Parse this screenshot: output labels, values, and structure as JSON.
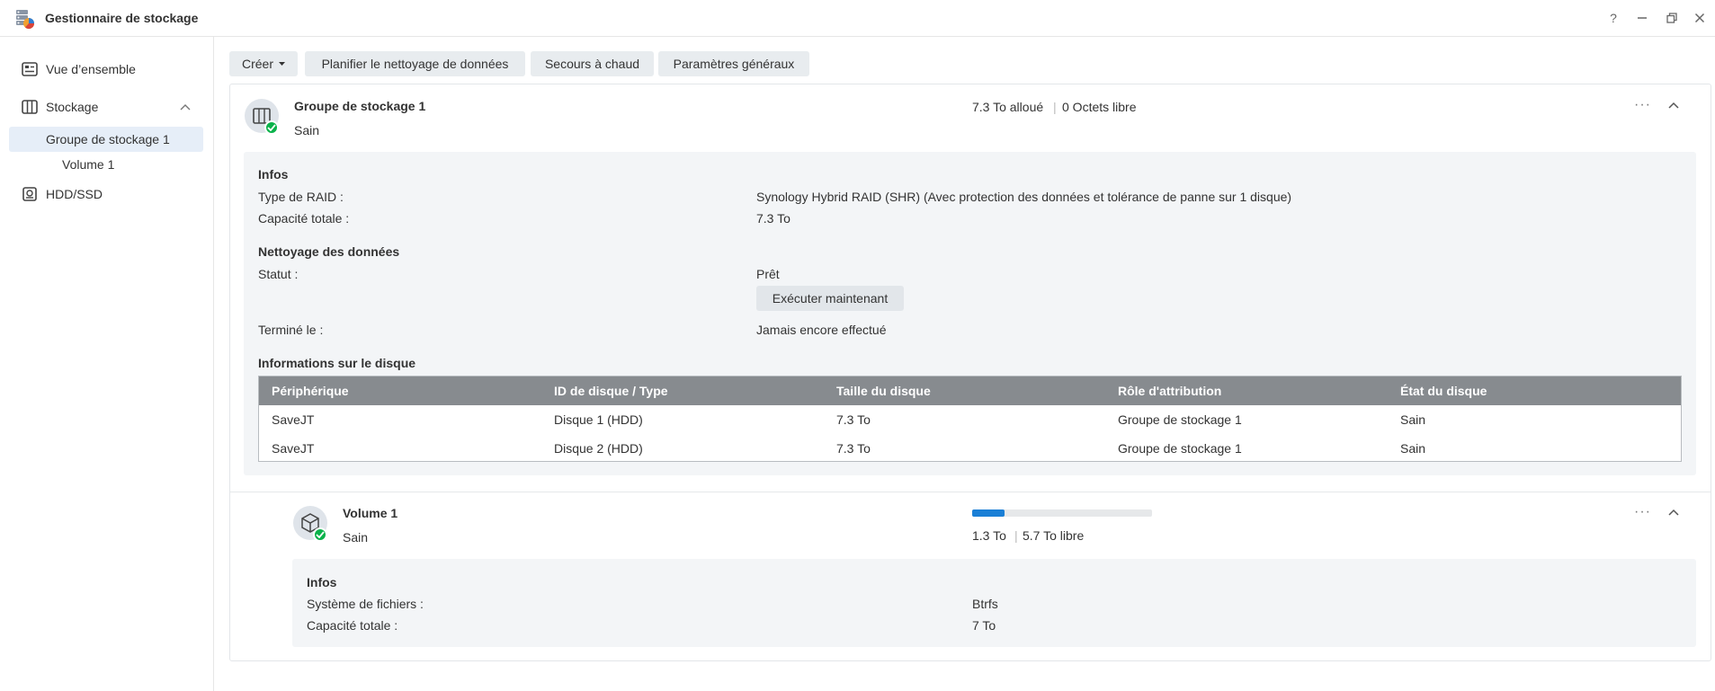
{
  "window": {
    "title": "Gestionnaire de stockage",
    "help_label": "?",
    "minimize_label": "—",
    "close_label": "✕"
  },
  "sidebar": {
    "overview": "Vue d’ensemble",
    "storage": "Stockage",
    "storage_pool": "Groupe de stockage 1",
    "volume": "Volume 1",
    "hdd_ssd": "HDD/SSD"
  },
  "toolbar": {
    "create": "Créer",
    "schedule_scrub": "Planifier le nettoyage de données",
    "hot_spare": "Secours à chaud",
    "global_settings": "Paramètres généraux"
  },
  "pool": {
    "name": "Groupe de stockage 1",
    "status": "Sain",
    "allocated": "7.3 To alloué",
    "separator": "|",
    "free": "0 Octets libre",
    "more": "···",
    "info_title": "Infos",
    "raid_label": "Type de RAID :",
    "raid_value": "Synology Hybrid RAID (SHR) (Avec protection des données et tolérance de panne sur 1 disque)",
    "capacity_label": "Capacité totale :",
    "capacity_value": "7.3 To",
    "scrub_title": "Nettoyage des données",
    "status_label": "Statut :",
    "status_value": "Prêt",
    "run_now": "Exécuter maintenant",
    "finished_label": "Terminé le :",
    "finished_value": "Jamais encore effectué",
    "disk_info_title": "Informations sur le disque",
    "columns": [
      "Périphérique",
      "ID de disque / Type",
      "Taille du disque",
      "Rôle d'attribution",
      "État du disque"
    ],
    "rows": [
      [
        "SaveJT",
        "Disque 1 (HDD)",
        "7.3 To",
        "Groupe de stockage 1",
        "Sain"
      ],
      [
        "SaveJT",
        "Disque 2 (HDD)",
        "7.3 To",
        "Groupe de stockage 1",
        "Sain"
      ]
    ]
  },
  "volume": {
    "name": "Volume 1",
    "status": "Sain",
    "used": "1.3 To",
    "separator": "|",
    "free": "5.7 To libre",
    "usage_fraction": 0.18,
    "more": "···",
    "info_title": "Infos",
    "fs_label": "Système de fichiers :",
    "fs_value": "Btrfs",
    "capacity_label": "Capacité totale :",
    "capacity_value": "7 To"
  },
  "colors": {
    "accent": "#1a7fd6",
    "healthy": "#0a9e2e",
    "table_header": "#878b8f"
  }
}
